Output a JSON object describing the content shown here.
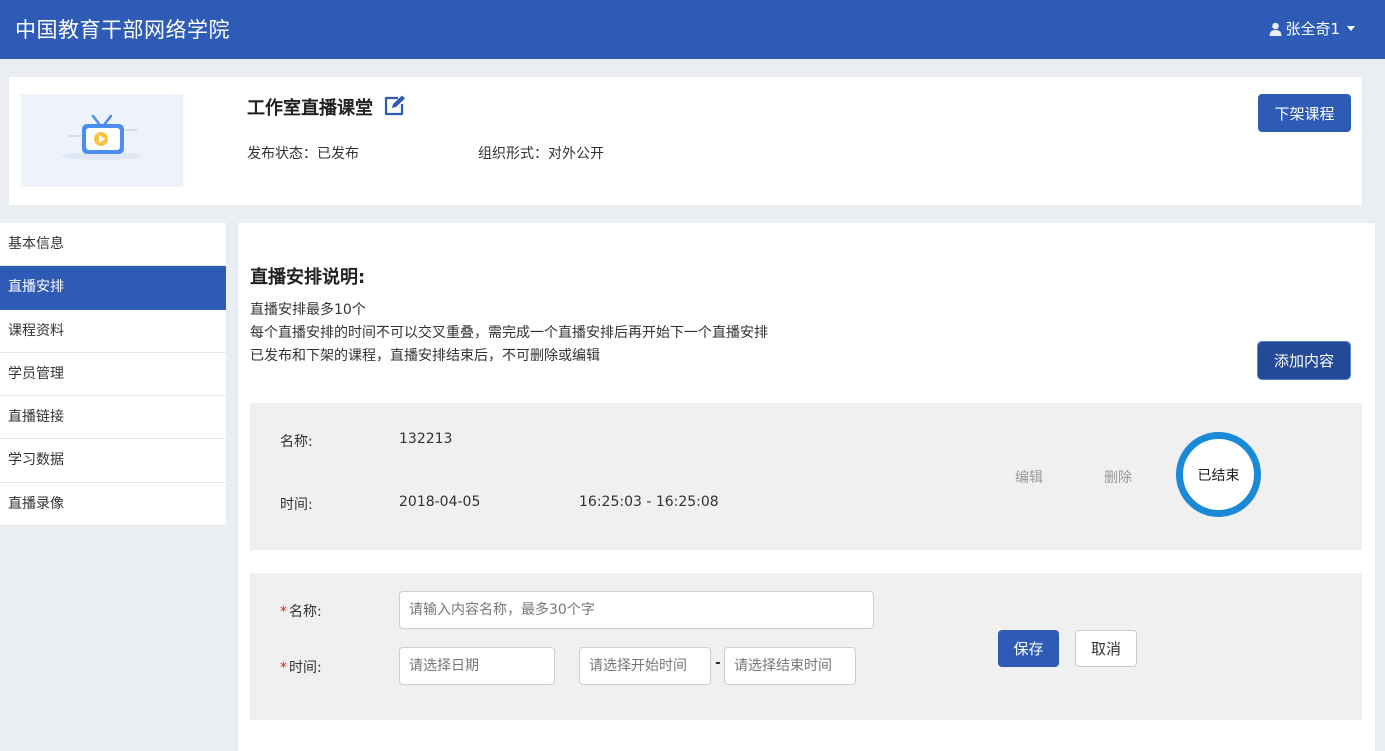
{
  "app": {
    "title": "中国教育干部网络学院"
  },
  "user": {
    "name": "张全奇1"
  },
  "course": {
    "title": "工作室直播课堂",
    "status_text": "发布状态：已发布",
    "org_text": "组织形式：对外公开",
    "unpublish_label": "下架课程"
  },
  "sidebar": {
    "items": [
      {
        "label": "基本信息",
        "active": false
      },
      {
        "label": "直播安排",
        "active": true
      },
      {
        "label": "课程资料",
        "active": false
      },
      {
        "label": "学员管理",
        "active": false
      },
      {
        "label": "直播链接",
        "active": false
      },
      {
        "label": "学习数据",
        "active": false
      },
      {
        "label": "直播录像",
        "active": false
      }
    ]
  },
  "schedule": {
    "heading": "直播安排说明:",
    "notes": [
      "直播安排最多10个",
      "每个直播安排的时间不可以交叉重叠，需完成一个直播安排后再开始下一个直播安排",
      "已发布和下架的课程，直播安排结束后，不可删除或编辑"
    ],
    "add_label": "添加内容",
    "record": {
      "name_label": "名称:",
      "name_value": "132213",
      "time_label": "时间:",
      "date_value": "2018-04-05",
      "time_range": "16:25:03 - 16:25:08",
      "edit_label": "编辑",
      "delete_label": "删除",
      "status_badge": "已结束"
    },
    "form": {
      "required_mark": "*",
      "name_label": "名称:",
      "name_placeholder": "请输入内容名称，最多30个字",
      "time_label": "时间:",
      "date_placeholder": "请选择日期",
      "start_placeholder": "请选择开始时间",
      "range_separator": "-",
      "end_placeholder": "请选择结束时间",
      "save_label": "保存",
      "cancel_label": "取消"
    }
  },
  "colors": {
    "brand": "#2d5bb5",
    "badge_ring": "#1a8ad6",
    "required": "#e02020"
  }
}
